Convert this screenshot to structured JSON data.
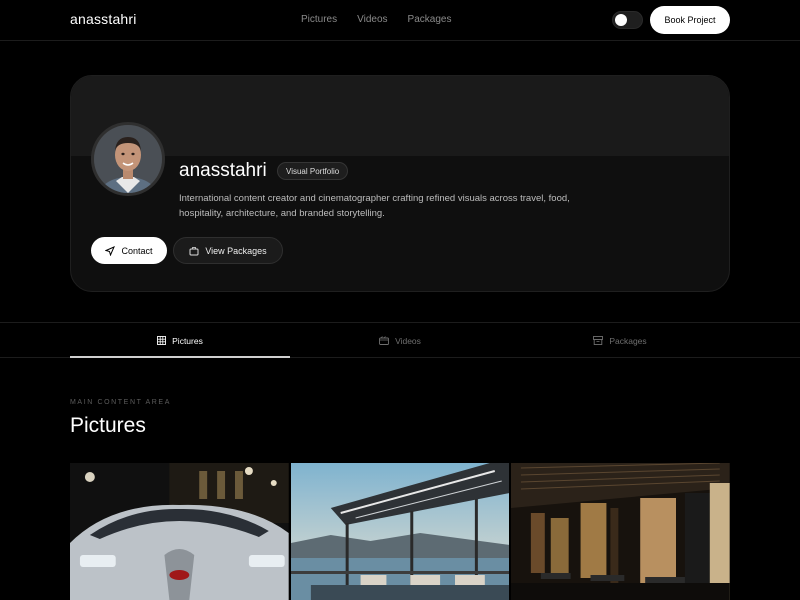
{
  "header": {
    "brand": "anasstahri",
    "nav": [
      "Pictures",
      "Videos",
      "Packages"
    ],
    "cta_label": "Book Project"
  },
  "profile": {
    "name": "anasstahri",
    "badge": "Visual Portfolio",
    "bio": "International content creator and cinematographer crafting refined visuals across travel, food, hospitality, architecture, and branded storytelling.",
    "contact_label": "Contact",
    "packages_label": "View Packages"
  },
  "tabs": [
    {
      "label": "Pictures",
      "icon": "grid-icon",
      "active": true
    },
    {
      "label": "Videos",
      "icon": "camera-icon",
      "active": false
    },
    {
      "label": "Packages",
      "icon": "package-icon",
      "active": false
    }
  ],
  "section": {
    "label": "MAIN CONTENT AREA",
    "title": "Pictures"
  },
  "gallery": [
    {
      "subject": "sports-car"
    },
    {
      "subject": "waterfront-terrace"
    },
    {
      "subject": "restaurant-interior"
    }
  ]
}
